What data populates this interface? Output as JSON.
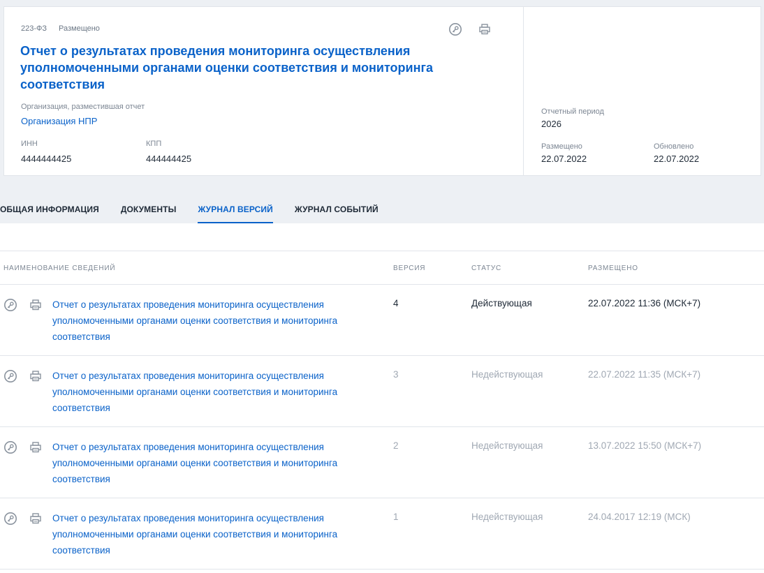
{
  "header": {
    "law": "223-ФЗ",
    "status": "Размещено",
    "title": "Отчет о результатах проведения мониторинга осуществления уполномоченными органами оценки соответствия и мониторинга соответствия",
    "org_label": "Организация, разместившая отчет",
    "org_value": "Организация НПР",
    "inn_label": "ИНН",
    "inn_value": "4444444425",
    "kpp_label": "КПП",
    "kpp_value": "444444425",
    "period_label": "Отчетный период",
    "period_value": "2026",
    "placed_label": "Размещено",
    "placed_value": "22.07.2022",
    "updated_label": "Обновлено",
    "updated_value": "22.07.2022"
  },
  "tabs": [
    {
      "label": "ОБЩАЯ ИНФОРМАЦИЯ"
    },
    {
      "label": "ДОКУМЕНТЫ"
    },
    {
      "label": "ЖУРНАЛ ВЕРСИЙ"
    },
    {
      "label": "ЖУРНАЛ СОБЫТИЙ"
    }
  ],
  "table": {
    "columns": {
      "name": "НАИМЕНОВАНИЕ СВЕДЕНИЙ",
      "version": "ВЕРСИЯ",
      "status": "СТАТУС",
      "placed": "РАЗМЕЩЕНО"
    },
    "rows": [
      {
        "name": "Отчет о результатах проведения мониторинга осуществления уполномоченными органами оценки соответствия и мониторинга соответствия",
        "version": "4",
        "status": "Действующая",
        "placed": "22.07.2022 11:36 (МСК+7)"
      },
      {
        "name": "Отчет о результатах проведения мониторинга осуществления уполномоченными органами оценки соответствия и мониторинга соответствия",
        "version": "3",
        "status": "Недействующая",
        "placed": "22.07.2022 11:35 (МСК+7)"
      },
      {
        "name": "Отчет о результатах проведения мониторинга осуществления уполномоченными органами оценки соответствия и мониторинга соответствия",
        "version": "2",
        "status": "Недействующая",
        "placed": "13.07.2022 15:50 (МСК+7)"
      },
      {
        "name": "Отчет о результатах проведения мониторинга осуществления уполномоченными органами оценки соответствия и мониторинга соответствия",
        "version": "1",
        "status": "Недействующая",
        "placed": "24.04.2017 12:19 (МСК)"
      }
    ]
  },
  "icons": {
    "signature": "key-icon",
    "print": "printer-icon"
  },
  "colors": {
    "accent": "#0a62c9",
    "muted": "#a0a8b3",
    "background": "#edf0f4"
  }
}
